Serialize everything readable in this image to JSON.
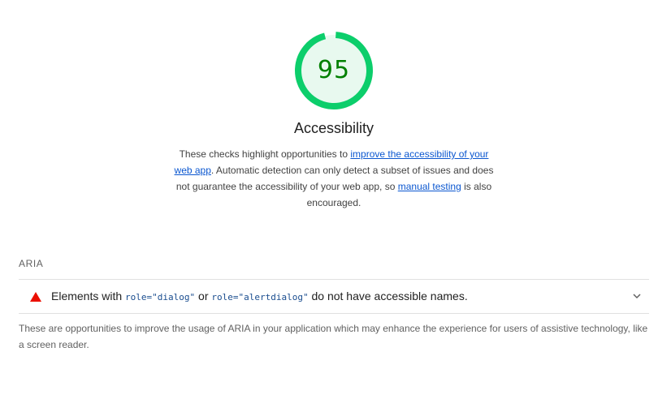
{
  "score": {
    "value": "95",
    "fraction": 0.95,
    "ring_color": "#0cce6b",
    "fill_color": "#e8f9ef",
    "text_color": "#008000"
  },
  "category": {
    "title": "Accessibility",
    "description": {
      "part1": "These checks highlight opportunities to ",
      "link1": "improve the accessibility of your web app",
      "part2": ". Automatic detection can only detect a subset of issues and does not guarantee the accessibility of your web app, so ",
      "link2": "manual testing",
      "part3": " is also encouraged."
    }
  },
  "group": {
    "title": "ARIA",
    "audit": {
      "status_icon": "fail-triangle-icon",
      "status_color": "#eb0f00",
      "title_part1": "Elements with ",
      "code1": "role=\"dialog\"",
      "title_part2": " or ",
      "code2": "role=\"alertdialog\"",
      "title_part3": " do not have accessible names.",
      "expand_icon": "chevron-down-icon"
    },
    "description": "These are opportunities to improve the usage of ARIA in your application which may enhance the experience for users of assistive technology, like a screen reader."
  }
}
